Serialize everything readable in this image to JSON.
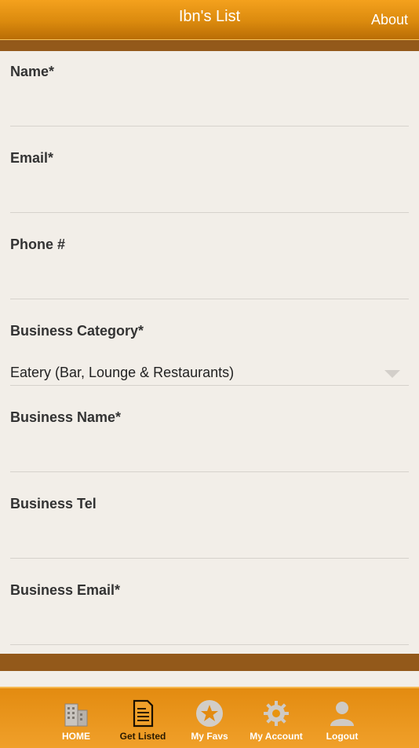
{
  "header": {
    "title": "Ibn's List",
    "about_label": "About"
  },
  "form": {
    "fields": [
      {
        "label": "Name*",
        "value": ""
      },
      {
        "label": "Email*",
        "value": ""
      },
      {
        "label": "Phone #",
        "value": ""
      },
      {
        "label": "Business Category*",
        "value": "Eatery (Bar, Lounge & Restaurants)"
      },
      {
        "label": "Business Name*",
        "value": ""
      },
      {
        "label": "Business Tel",
        "value": ""
      },
      {
        "label": "Business Email*",
        "value": ""
      }
    ]
  },
  "tabbar": {
    "items": [
      {
        "label": "HOME",
        "icon": "building-icon"
      },
      {
        "label": "Get Listed",
        "icon": "document-icon",
        "active": true
      },
      {
        "label": "My Favs",
        "icon": "star-icon"
      },
      {
        "label": "My Account",
        "icon": "gear-icon"
      },
      {
        "label": "Logout",
        "icon": "user-icon"
      }
    ]
  },
  "colors": {
    "header_orange": "#e8940f",
    "brown_bar": "#93591a",
    "background": "#f2eee8",
    "active_label": "#2a1a00"
  }
}
